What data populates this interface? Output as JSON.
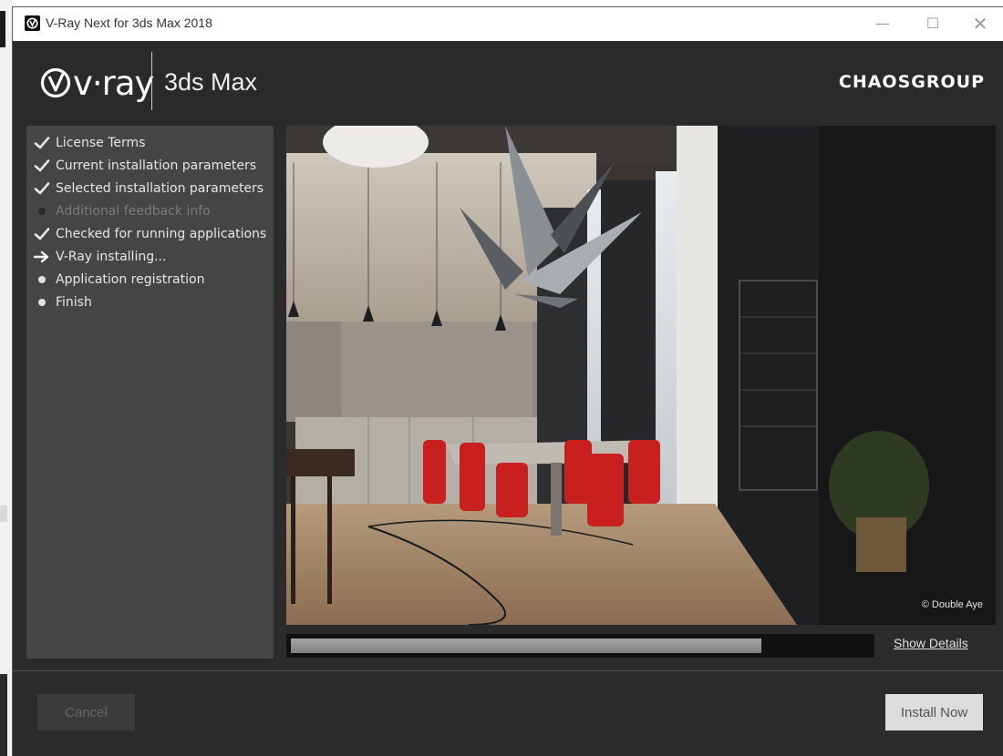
{
  "window": {
    "title": "V-Ray Next for 3ds Max 2018",
    "controls": {
      "minimize": "—",
      "maximize": "☐",
      "close": "✕"
    }
  },
  "header": {
    "logo_text": "v·ray",
    "product": "3ds Max",
    "brand": "CHAOSGROUP"
  },
  "steps": [
    {
      "label": "License Terms",
      "status": "done",
      "icon": "check-icon"
    },
    {
      "label": "Current installation parameters",
      "status": "done",
      "icon": "check-icon"
    },
    {
      "label": "Selected installation parameters",
      "status": "done",
      "icon": "check-icon"
    },
    {
      "label": "Additional feedback info",
      "status": "skipped",
      "icon": "dot-icon"
    },
    {
      "label": "Checked for running applications",
      "status": "done",
      "icon": "check-icon"
    },
    {
      "label": "V-Ray installing...",
      "status": "current",
      "icon": "arrow-right-icon"
    },
    {
      "label": "Application registration",
      "status": "pending",
      "icon": "dot-icon"
    },
    {
      "label": "Finish",
      "status": "pending",
      "icon": "dot-icon"
    }
  ],
  "preview": {
    "credit": "© Double Aye"
  },
  "progress": {
    "fraction": 0.8,
    "details_label": "Show Details"
  },
  "buttons": {
    "cancel": "Cancel",
    "install": "Install Now"
  }
}
